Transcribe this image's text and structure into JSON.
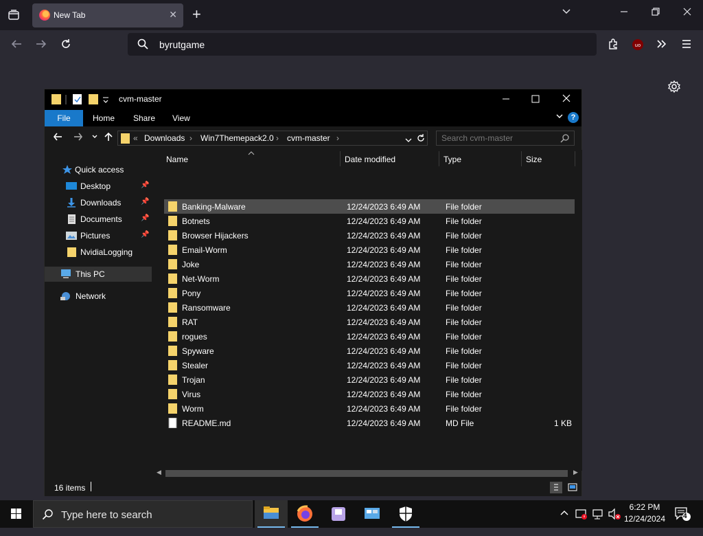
{
  "browser": {
    "tab_title": "New Tab",
    "url_text": "byrutgame"
  },
  "explorer": {
    "title": "cvm-master",
    "ribbon_tabs": [
      "File",
      "Home",
      "Share",
      "View"
    ],
    "breadcrumb": [
      "Downloads",
      "Win7Themepack2.0",
      "cvm-master"
    ],
    "search_placeholder": "Search cvm-master",
    "nav": {
      "quick_access": "Quick access",
      "pinned": [
        "Desktop",
        "Downloads",
        "Documents",
        "Pictures"
      ],
      "other": "NvidiaLogging",
      "this_pc": "This PC",
      "network": "Network"
    },
    "columns": [
      "Name",
      "Date modified",
      "Type",
      "Size"
    ],
    "files": [
      {
        "name": "Banking-Malware",
        "date": "12/24/2023 6:49 AM",
        "type": "File folder",
        "size": ""
      },
      {
        "name": "Botnets",
        "date": "12/24/2023 6:49 AM",
        "type": "File folder",
        "size": ""
      },
      {
        "name": "Browser Hijackers",
        "date": "12/24/2023 6:49 AM",
        "type": "File folder",
        "size": ""
      },
      {
        "name": "Email-Worm",
        "date": "12/24/2023 6:49 AM",
        "type": "File folder",
        "size": ""
      },
      {
        "name": "Joke",
        "date": "12/24/2023 6:49 AM",
        "type": "File folder",
        "size": ""
      },
      {
        "name": "Net-Worm",
        "date": "12/24/2023 6:49 AM",
        "type": "File folder",
        "size": ""
      },
      {
        "name": "Pony",
        "date": "12/24/2023 6:49 AM",
        "type": "File folder",
        "size": ""
      },
      {
        "name": "Ransomware",
        "date": "12/24/2023 6:49 AM",
        "type": "File folder",
        "size": ""
      },
      {
        "name": "RAT",
        "date": "12/24/2023 6:49 AM",
        "type": "File folder",
        "size": ""
      },
      {
        "name": "rogues",
        "date": "12/24/2023 6:49 AM",
        "type": "File folder",
        "size": ""
      },
      {
        "name": "Spyware",
        "date": "12/24/2023 6:49 AM",
        "type": "File folder",
        "size": ""
      },
      {
        "name": "Stealer",
        "date": "12/24/2023 6:49 AM",
        "type": "File folder",
        "size": ""
      },
      {
        "name": "Trojan",
        "date": "12/24/2023 6:49 AM",
        "type": "File folder",
        "size": ""
      },
      {
        "name": "Virus",
        "date": "12/24/2023 6:49 AM",
        "type": "File folder",
        "size": ""
      },
      {
        "name": "Worm",
        "date": "12/24/2023 6:49 AM",
        "type": "File folder",
        "size": ""
      },
      {
        "name": "README.md",
        "date": "12/24/2023 6:49 AM",
        "type": "MD File",
        "size": "1 KB"
      }
    ],
    "status": "16 items"
  },
  "taskbar": {
    "search_placeholder": "Type here to search",
    "time": "6:22 PM",
    "date": "12/24/2024",
    "notification_count": "4"
  },
  "colors": {
    "accent": "#1979ca",
    "folder": "#f5d36b",
    "browser_bg": "#2b2a33",
    "explorer_bg": "#191919"
  }
}
